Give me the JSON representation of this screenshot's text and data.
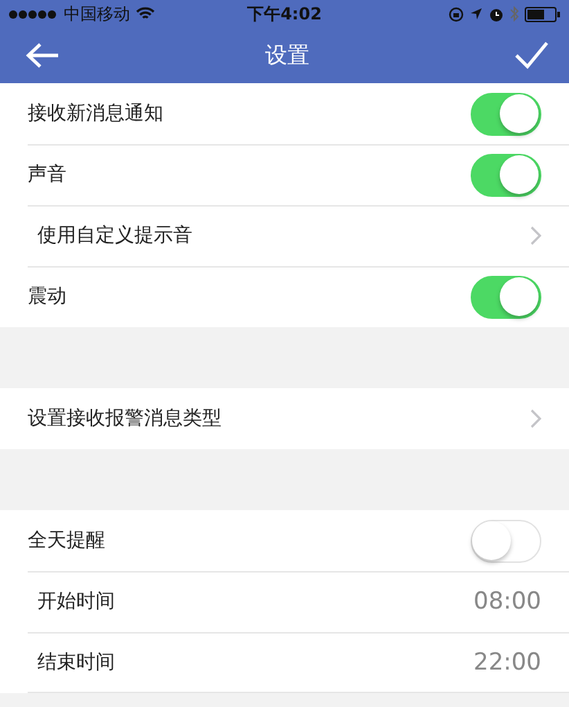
{
  "status_bar": {
    "carrier": "中国移动",
    "time": "下午4:02"
  },
  "header": {
    "title": "设置"
  },
  "sections": [
    {
      "rows": [
        {
          "kind": "toggle",
          "label": "接收新消息通知",
          "on": true
        },
        {
          "kind": "toggle",
          "label": "声音",
          "on": true,
          "children": [
            {
              "kind": "link",
              "label": "使用自定义提示音"
            }
          ]
        },
        {
          "kind": "toggle",
          "label": "震动",
          "on": true
        }
      ]
    },
    {
      "rows": [
        {
          "kind": "link",
          "label": "设置接收报警消息类型"
        }
      ]
    },
    {
      "rows": [
        {
          "kind": "toggle",
          "label": "全天提醒",
          "on": false,
          "children": [
            {
              "kind": "value",
              "label": "开始时间",
              "value": "08:00"
            },
            {
              "kind": "value",
              "label": "结束时间",
              "value": "22:00"
            }
          ]
        }
      ]
    }
  ]
}
